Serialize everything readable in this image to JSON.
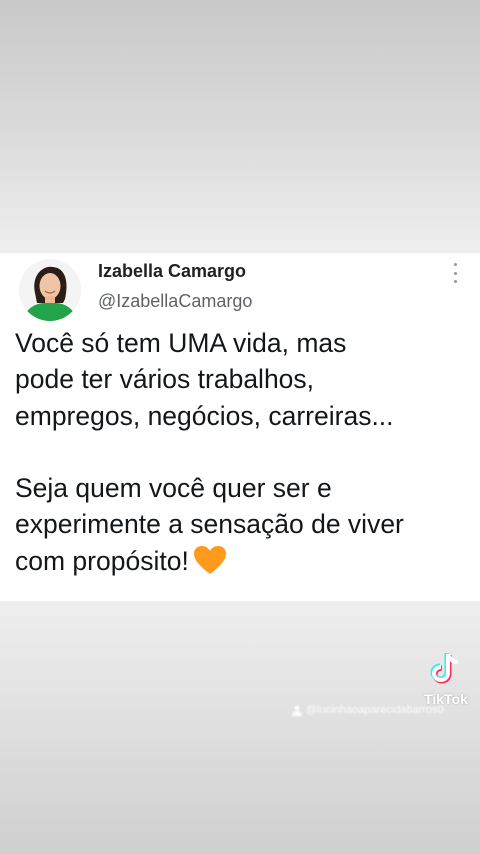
{
  "tweet": {
    "author_name": "Izabella Camargo",
    "author_handle": "@IzabellaCamargo",
    "lines": [
      "Você só tem UMA vida, mas",
      "pode ter vários trabalhos,",
      "empregos, negócios, carreiras...",
      "",
      "Seja quem você quer ser e",
      "experimente a sensação de viver",
      "com propósito!"
    ],
    "emoji": "orange-heart-icon",
    "accent_color": "#ff9a1f"
  },
  "overlay": {
    "tiktok_label": "TikTok",
    "watermark_user": "@lucinhaoaparecidabarros0"
  },
  "colors": {
    "avatar_shirt": "#23a44a",
    "text": "#14171a",
    "handle": "#5f6368"
  }
}
